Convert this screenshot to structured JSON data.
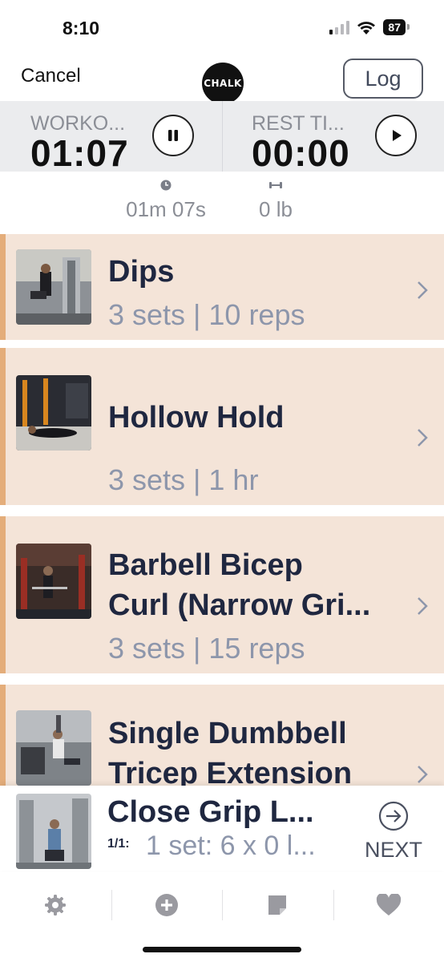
{
  "status_bar": {
    "time": "8:10",
    "battery": "87"
  },
  "nav": {
    "cancel_label": "Cancel",
    "logo_text": "CHALK",
    "log_label": "Log"
  },
  "timers": {
    "workout": {
      "label": "WORKO...",
      "value": "01:07"
    },
    "rest": {
      "label": "REST TI...",
      "value": "00:00"
    }
  },
  "stats": {
    "duration": "01m 07s",
    "weight": "0 lb"
  },
  "exercises": [
    {
      "title": "Dips",
      "meta": "3 sets | 10 reps"
    },
    {
      "title": "Hollow Hold",
      "meta": "3 sets | 1 hr"
    },
    {
      "title_line1": "Barbell Bicep",
      "title_line2": "Curl (Narrow Gri...",
      "meta": "3 sets | 15 reps"
    },
    {
      "title_line1": "Single Dumbbell",
      "title_line2": "Tricep Extension"
    }
  ],
  "current": {
    "title": "Close Grip L...",
    "index": "1/1:",
    "sets": "1 set: 6 x 0 l...",
    "next_label": "NEXT"
  },
  "colors": {
    "card_bg": "#f4e4d8",
    "card_accent": "#e4ad7a",
    "title": "#1f2740",
    "meta": "#8d96ab"
  },
  "tab_icons": [
    "gear-icon",
    "add-circle-icon",
    "note-icon",
    "heart-icon"
  ]
}
